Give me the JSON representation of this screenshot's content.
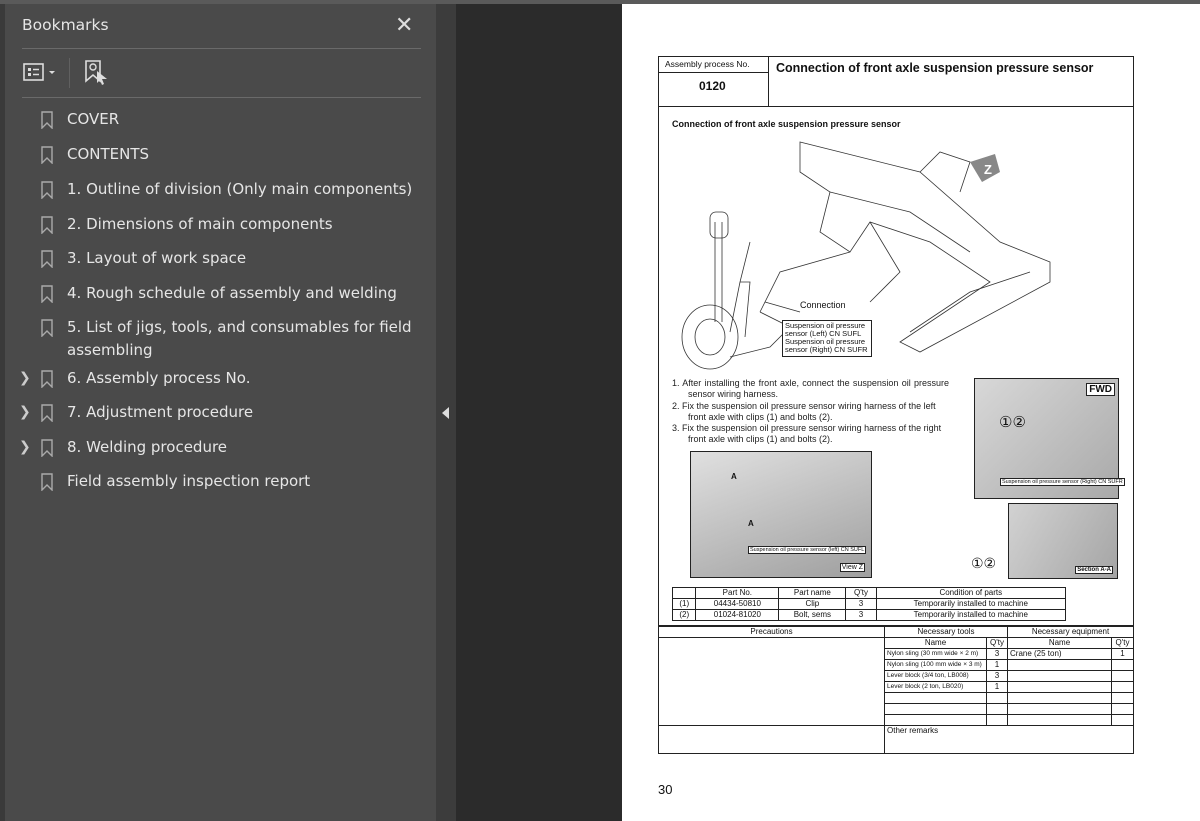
{
  "sidebar": {
    "title": "Bookmarks",
    "close_icon": "close-icon",
    "items": [
      {
        "label": "COVER",
        "expandable": false
      },
      {
        "label": "CONTENTS",
        "expandable": false
      },
      {
        "label": "1. Outline of division (Only main components)",
        "expandable": false
      },
      {
        "label": "2. Dimensions of main components",
        "expandable": false
      },
      {
        "label": "3. Layout of work space",
        "expandable": false
      },
      {
        "label": "4. Rough schedule of assembly and welding",
        "expandable": false
      },
      {
        "label": "5. List of jigs, tools, and consumables for field assembling",
        "expandable": false
      },
      {
        "label": "6. Assembly process No.",
        "expandable": true
      },
      {
        "label": "7. Adjustment procedure",
        "expandable": true
      },
      {
        "label": "8. Welding procedure",
        "expandable": true
      },
      {
        "label": "Field assembly inspection report",
        "expandable": false
      }
    ]
  },
  "document": {
    "header": {
      "process_label": "Assembly process No.",
      "process_no": "0120",
      "title": "Connection of front axle suspension pressure sensor"
    },
    "figure_title": "Connection of front axle suspension pressure sensor",
    "figure_labels": {
      "z": "Z",
      "connection": "Connection",
      "sensor_box": [
        "Suspension oil pressure",
        "sensor (Left) CN SUFL",
        "Suspension oil pressure",
        "sensor (Right) CN SUFR"
      ],
      "fwd": "FWD",
      "circled": "①②",
      "right_sensor": "Suspension oil pressure sensor (Right) CN SUFR",
      "left_sensor": "Suspension oil pressure sensor (left) CN SUFL",
      "a": "A",
      "view_z": "View Z",
      "section": "Section A-A"
    },
    "steps": [
      "1.  After installing the front axle, connect the suspension oil pressure sensor wiring harness.",
      "2.  Fix the suspension oil pressure sensor wiring harness of the left front axle with clips (1) and bolts (2).",
      "3.  Fix the suspension oil pressure sensor wiring harness of the right front axle with clips (1) and bolts (2)."
    ],
    "parts": {
      "headers": [
        "",
        "Part No.",
        "Part name",
        "Q'ty",
        "Condition of parts"
      ],
      "rows": [
        [
          "(1)",
          "04434-50810",
          "Clip",
          "3",
          "Temporarily installed to machine"
        ],
        [
          "(2)",
          "01024-81020",
          "Bolt, sems",
          "3",
          "Temporarily installed to machine"
        ]
      ]
    },
    "bottom": {
      "precautions": "Precautions",
      "tools": "Necessary tools",
      "equipment": "Necessary equipment",
      "name": "Name",
      "qty": "Q'ty",
      "tool_rows": [
        [
          "Nylon sling (30 mm wide × 2 m)",
          "3"
        ],
        [
          "Nylon sling (100 mm wide × 3 m)",
          "1"
        ],
        [
          "Lever block (3/4 ton, LB008)",
          "3"
        ],
        [
          "Lever block (2 ton, LB020)",
          "1"
        ],
        [
          "",
          ""
        ],
        [
          "",
          ""
        ],
        [
          "",
          ""
        ]
      ],
      "equip_rows": [
        [
          "Crane (25 ton)",
          "1"
        ],
        [
          "",
          ""
        ],
        [
          "",
          ""
        ],
        [
          "",
          ""
        ],
        [
          "",
          ""
        ],
        [
          "",
          ""
        ],
        [
          "",
          ""
        ]
      ],
      "other_remarks": "Other remarks"
    },
    "page_number": "30"
  }
}
